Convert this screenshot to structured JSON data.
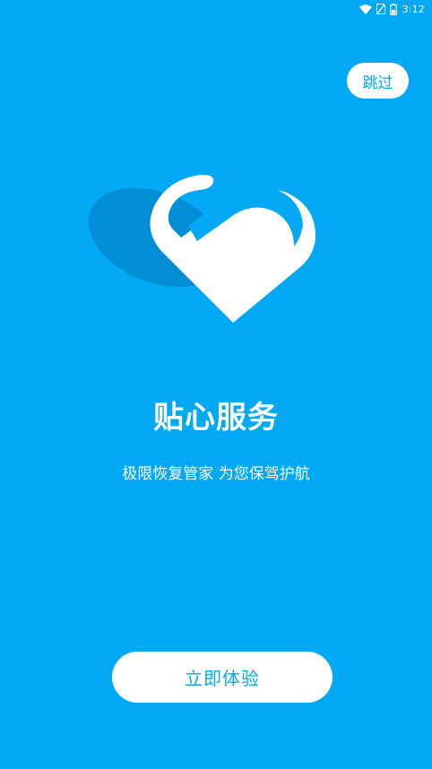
{
  "status_bar": {
    "time": "3:12",
    "icons": [
      "wifi-icon",
      "no-sim-icon",
      "battery-icon"
    ]
  },
  "skip": {
    "label": "跳过"
  },
  "illustration": {
    "name": "heart-icon"
  },
  "content": {
    "title": "贴心服务",
    "subtitle": "极限恢复管家 为您保驾护航"
  },
  "cta": {
    "label": "立即体验"
  },
  "colors": {
    "background": "#03A9F4",
    "shadow": "#0288D1",
    "white": "#FFFFFF"
  }
}
